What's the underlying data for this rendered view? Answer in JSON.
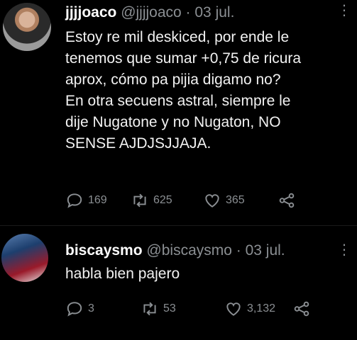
{
  "tweets": [
    {
      "name": "jjjjoaco",
      "handle": "@jjjjoaco · 03 jul.",
      "text": "Estoy re mil deskiced, por ende le\ntenemos que sumar +0,75 de ricura\naprox, cómo pa pijia digamo no?\nEn otra secuens astral, siempre le\ndije Nugatone y no Nugaton, NO\nSENSE AJDJSJJAJA.",
      "replies": "169",
      "retweets": "625",
      "likes": "365"
    },
    {
      "name": "biscaysmo",
      "handle": "@biscaysmo · 03 jul.",
      "text": "habla bien pajero",
      "replies": "3",
      "retweets": "53",
      "likes": "3,132"
    }
  ],
  "icons": {
    "reply": "reply-icon",
    "retweet": "retweet-icon",
    "like": "like-icon",
    "share": "share-icon",
    "more": "more-icon"
  }
}
